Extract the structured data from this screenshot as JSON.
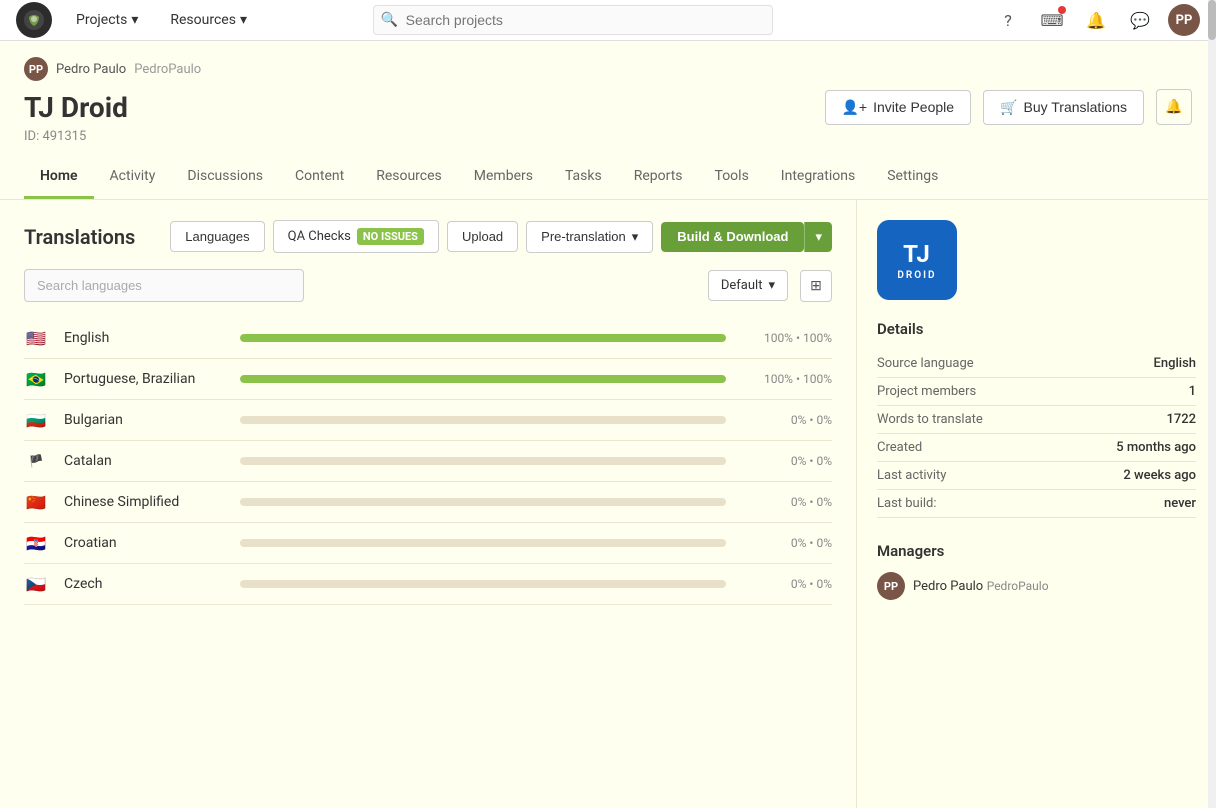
{
  "topnav": {
    "logo_text": "C",
    "projects_label": "Projects",
    "resources_label": "Resources",
    "search_placeholder": "Search projects"
  },
  "project": {
    "user_name": "Pedro Paulo",
    "user_handle": "PedroPaulo",
    "title": "TJ Droid",
    "id_label": "ID: 491315",
    "invite_label": "Invite People",
    "buy_label": "Buy Translations"
  },
  "tabs": [
    {
      "label": "Home",
      "active": true
    },
    {
      "label": "Activity",
      "active": false
    },
    {
      "label": "Discussions",
      "active": false
    },
    {
      "label": "Content",
      "active": false
    },
    {
      "label": "Resources",
      "active": false
    },
    {
      "label": "Members",
      "active": false
    },
    {
      "label": "Tasks",
      "active": false
    },
    {
      "label": "Reports",
      "active": false
    },
    {
      "label": "Tools",
      "active": false
    },
    {
      "label": "Integrations",
      "active": false
    },
    {
      "label": "Settings",
      "active": false
    }
  ],
  "translations": {
    "title": "Translations",
    "languages_btn": "Languages",
    "qa_label": "QA Checks",
    "qa_status": "NO ISSUES",
    "upload_btn": "Upload",
    "pretranslation_btn": "Pre-translation",
    "build_btn": "Build & Download",
    "search_placeholder": "Search languages",
    "sort_label": "Default"
  },
  "languages": [
    {
      "flag": "🇺🇸",
      "name": "English",
      "progress": 100,
      "text": "100% • 100%"
    },
    {
      "flag": "🇧🇷",
      "name": "Portuguese, Brazilian",
      "progress": 100,
      "text": "100% • 100%"
    },
    {
      "flag": "🇧🇬",
      "name": "Bulgarian",
      "progress": 0,
      "text": "0% • 0%"
    },
    {
      "flag": "🏳️",
      "name": "Catalan",
      "progress": 0,
      "text": "0% • 0%"
    },
    {
      "flag": "🇨🇳",
      "name": "Chinese Simplified",
      "progress": 0,
      "text": "0% • 0%"
    },
    {
      "flag": "🇭🇷",
      "name": "Croatian",
      "progress": 0,
      "text": "0% • 0%"
    },
    {
      "flag": "🇨🇿",
      "name": "Czech",
      "progress": 0,
      "text": "0% • 0%"
    }
  ],
  "details": {
    "title": "Details",
    "source_language_label": "Source language",
    "source_language_value": "English",
    "project_members_label": "Project members",
    "project_members_value": "1",
    "words_label": "Words to translate",
    "words_value": "1722",
    "created_label": "Created",
    "created_value": "5 months ago",
    "last_activity_label": "Last activity",
    "last_activity_value": "2 weeks ago",
    "last_build_label": "Last build:",
    "last_build_value": "never"
  },
  "managers": {
    "title": "Managers",
    "name": "Pedro Paulo",
    "handle": "PedroPaulo"
  },
  "logo": {
    "line1": "TJ",
    "line2": "DROID"
  }
}
